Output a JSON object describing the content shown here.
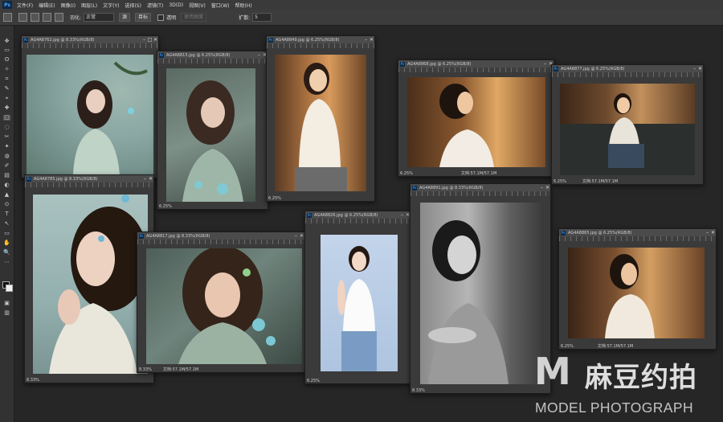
{
  "menubar": {
    "app_logo": "Ps",
    "items": [
      "文件(F)",
      "编辑(E)",
      "图像(I)",
      "图层(L)",
      "文字(Y)",
      "选择(S)",
      "滤镜(T)",
      "3D(D)",
      "视图(V)",
      "窗口(W)",
      "帮助(H)"
    ]
  },
  "options": {
    "feather_label": "羽化:",
    "mode_value": "正常",
    "btn_source": "源",
    "btn_target": "目标",
    "transparent_label": "透明",
    "use_pattern": "使用图案",
    "spread_label": "扩散:",
    "spread_value": "5"
  },
  "tools": [
    "✥",
    "▭",
    "ʘ",
    "✧",
    "⌗",
    "✎",
    "⌖",
    "✚",
    "▢",
    "◌",
    "✂",
    "✦",
    "◍",
    "✐",
    "▤",
    "◐",
    "▲",
    "⊙",
    "T",
    "↖",
    "▭",
    "✋",
    "🔍",
    "⋯",
    "■",
    "▣",
    "▥"
  ],
  "windows": [
    {
      "title": "AG4A8762.jpg @ 8.33%(RGB/8)",
      "zoom": "8.33%",
      "doc": ""
    },
    {
      "title": "AG4A8815.jpg @ 6.25%(RGB/8)",
      "zoom": "6.25%",
      "doc": ""
    },
    {
      "title": "AG4A8849.jpg @ 6.25%(RGB/8)",
      "zoom": "6.25%",
      "doc": ""
    },
    {
      "title": "AG4A8868.jpg @ 6.25%(RGB/8)",
      "zoom": "6.25%",
      "doc": "文档:57.1M/57.1M"
    },
    {
      "title": "AG4A8877.jpg @ 6.25%(RGB/8)",
      "zoom": "6.25%",
      "doc": "文档:57.1M/57.1M"
    },
    {
      "title": "AG4A8785.jpg @ 8.33%(RGB/8)",
      "zoom": "8.33%",
      "doc": ""
    },
    {
      "title": "AG4A8817.jpg @ 8.33%(RGB/8)",
      "zoom": "8.33%",
      "doc": "文档:57.1M/57.1M"
    },
    {
      "title": "AG4A8826.jpg @ 6.25%(RGB/8)",
      "zoom": "6.25%",
      "doc": ""
    },
    {
      "title": "AG4A8891.jpg @ 8.33%(RGB/8)",
      "zoom": "8.33%",
      "doc": ""
    },
    {
      "title": "AG4A8865.jpg @ 6.25%(RGB/8)",
      "zoom": "6.25%",
      "doc": "文档:57.1M/57.1M"
    }
  ],
  "watermark": {
    "logo_letter": "M",
    "cn": "麻豆约拍",
    "en": "MODEL PHOTOGRAPH"
  }
}
